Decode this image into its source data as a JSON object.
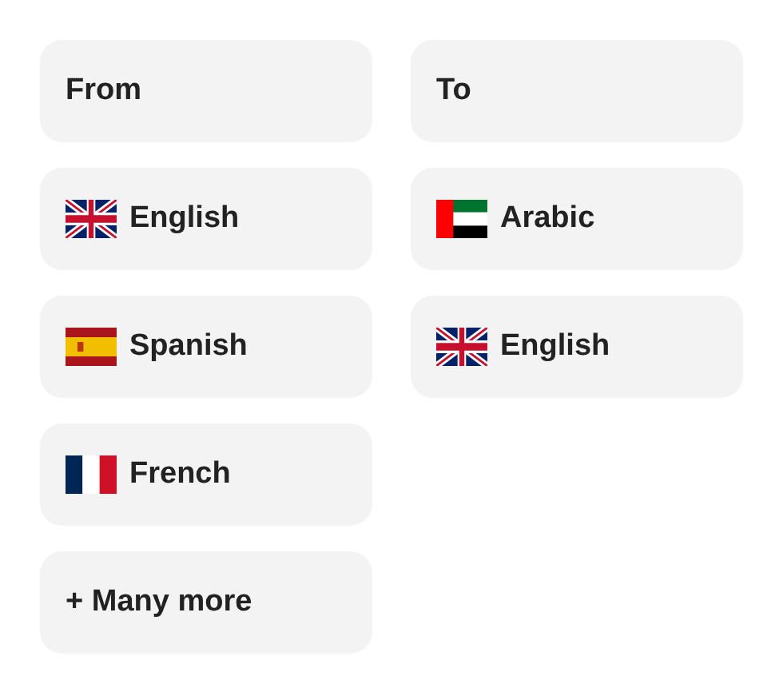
{
  "columns": [
    {
      "heading": "From",
      "languages": [
        {
          "name": "English",
          "kind": "uk"
        },
        {
          "name": "Spanish",
          "kind": "spain"
        },
        {
          "name": "French",
          "kind": "france"
        }
      ],
      "more": "+ Many more"
    },
    {
      "heading": "To",
      "languages": [
        {
          "name": "Arabic",
          "kind": "uae"
        },
        {
          "name": "English",
          "kind": "uk"
        }
      ]
    }
  ]
}
